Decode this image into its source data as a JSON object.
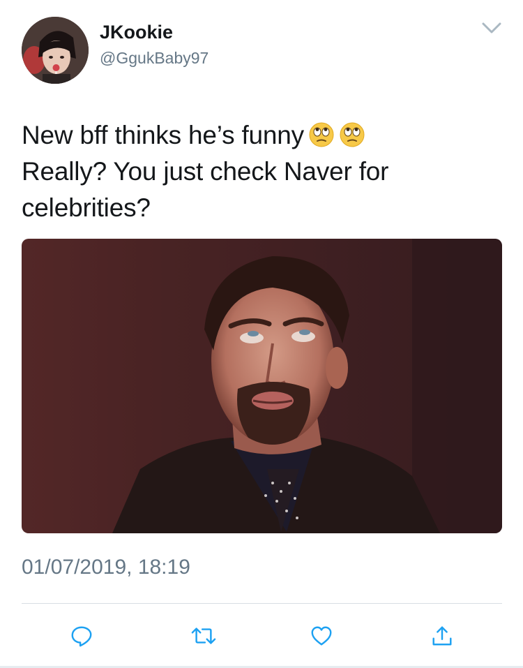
{
  "user": {
    "display_name": "JKookie",
    "handle": "@GgukBaby97"
  },
  "tweet": {
    "line1": "New bff thinks he’s funny",
    "line2": "Really? You just check Naver for",
    "line3": "celebrities?",
    "emojis": [
      "face-with-rolling-eyes-icon",
      "face-with-rolling-eyes-icon"
    ],
    "timestamp": "01/07/2019, 18:19"
  },
  "actions": [
    "reply-icon",
    "retweet-icon",
    "like-icon",
    "share-icon"
  ],
  "colors": {
    "text": "#14171a",
    "secondary": "#657786",
    "icon": "#1da1f2",
    "divider": "#d8dee3"
  }
}
